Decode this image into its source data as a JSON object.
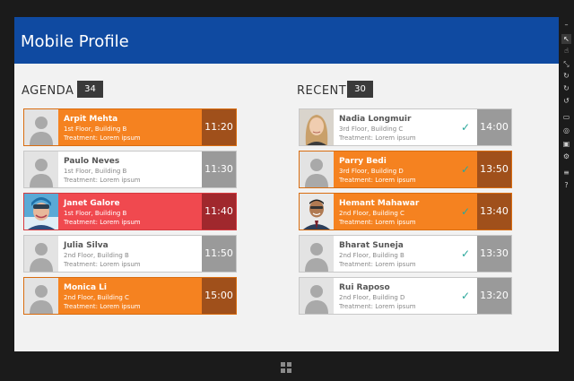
{
  "app": {
    "title": "Mobile Profile"
  },
  "agenda": {
    "title": "AGENDA",
    "count": "34",
    "items": [
      {
        "name": "Arpit Mehta",
        "location": "1st Floor, Building B",
        "treatment": "Treatment: Lorem ipsum",
        "time": "11:20",
        "style": "orange",
        "photo": false
      },
      {
        "name": "Paulo Neves",
        "location": "1st Floor, Building B",
        "treatment": "Treatment: Lorem ipsum",
        "time": "11:30",
        "style": "plain",
        "photo": false
      },
      {
        "name": "Janet Galore",
        "location": "1st Floor, Building B",
        "treatment": "Treatment: Lorem ipsum",
        "time": "11:40",
        "style": "red",
        "photo": true
      },
      {
        "name": "Julia Silva",
        "location": "2nd Floor, Building B",
        "treatment": "Treatment: Lorem ipsum",
        "time": "11:50",
        "style": "plain",
        "photo": false
      },
      {
        "name": "Monica Li",
        "location": "2nd Floor, Building C",
        "treatment": "Treatment: Lorem ipsum",
        "time": "15:00",
        "style": "orange",
        "photo": false
      }
    ]
  },
  "recent": {
    "title": "RECENT",
    "count": "30",
    "items": [
      {
        "name": "Nadia Longmuir",
        "location": "3rd Floor, Building C",
        "treatment": "Treatment: Lorem ipsum",
        "time": "14:00",
        "style": "plain",
        "photo": true
      },
      {
        "name": "Parry Bedi",
        "location": "3rd Floor, Building D",
        "treatment": "Treatment: Lorem ipsum",
        "time": "13:50",
        "style": "orange",
        "photo": false
      },
      {
        "name": "Hemant Mahawar",
        "location": "2nd Floor, Building C",
        "treatment": "Treatment: Lorem ipsum",
        "time": "13:40",
        "style": "orange",
        "photo": true
      },
      {
        "name": "Bharat Suneja",
        "location": "2nd Floor, Building B",
        "treatment": "Treatment: Lorem ipsum",
        "time": "13:30",
        "style": "plain",
        "photo": false
      },
      {
        "name": "Rui Raposo",
        "location": "2nd Floor, Building D",
        "treatment": "Treatment: Lorem ipsum",
        "time": "13:20",
        "style": "plain",
        "photo": false
      }
    ]
  },
  "simulator": {
    "tools": [
      "minimize-icon",
      "pointer-icon",
      "touch-icon",
      "pinch-icon",
      "rotate-touch-icon",
      "rotate-clockwise-icon",
      "rotate-counterclockwise-icon",
      "resolution-icon",
      "location-icon",
      "screenshot-icon",
      "settings-icon",
      "network-icon",
      "help-icon"
    ],
    "help_label": "?"
  },
  "colors": {
    "accent": "#0f4aa1",
    "orange": "#f58220",
    "red": "#f0494f",
    "check": "#2aa79b"
  }
}
